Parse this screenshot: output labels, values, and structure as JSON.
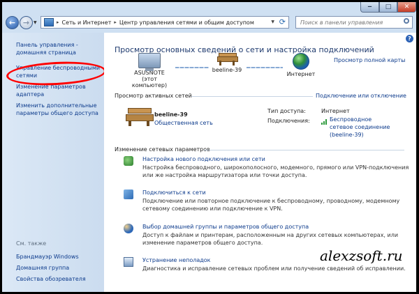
{
  "window_controls": {
    "minimize": "‒",
    "maximize": "□",
    "close": "✕"
  },
  "nav": {
    "back_glyph": "←",
    "forward_glyph": "→",
    "breadcrumb": [
      "Сеть и Интернет",
      "Центр управления сетями и общим доступом"
    ],
    "search_placeholder": "Поиск в панели управления"
  },
  "sidebar": {
    "links": [
      "Панель управления - домашняя страница",
      "Управление беспроводными сетями",
      "Изменение параметров адаптера",
      "Изменить дополнительные параметры общего доступа"
    ],
    "see_also_title": "См. также",
    "see_also": [
      "Брандмауэр Windows",
      "Домашняя группа",
      "Свойства обозревателя"
    ]
  },
  "main": {
    "title": "Просмотр основных сведений о сети и настройка подключений",
    "full_map": "Просмотр полной карты",
    "map": [
      {
        "name": "ASUSNOTE",
        "sub": "(этот компьютер)",
        "icon": "computer-icon"
      },
      {
        "name": "beeline-39",
        "sub": "",
        "icon": "bench-icon"
      },
      {
        "name": "Интернет",
        "sub": "",
        "icon": "globe-icon"
      }
    ],
    "active_title": "Просмотр активных сетей",
    "connect_disconnect": "Подключение или отключение",
    "active_network": {
      "name": "beeline-39",
      "type": "Общественная сеть",
      "access_label": "Тип доступа:",
      "access_value": "Интернет",
      "connections_label": "Подключения:",
      "connections_value": "Беспроводное сетевое соединение (beeline-39)"
    },
    "change_title": "Изменение сетевых параметров",
    "tasks": [
      {
        "title": "Настройка нового подключения или сети",
        "desc": "Настройка беспроводного, широкополосного, модемного, прямого или VPN-подключения или же настройка маршрутизатора или точки доступа.",
        "icon": "new-connection-icon"
      },
      {
        "title": "Подключиться к сети",
        "desc": "Подключение или повторное подключение к беспроводному, проводному, модемному сетевому соединению или подключение к VPN.",
        "icon": "connect-network-icon"
      },
      {
        "title": "Выбор домашней группы и параметров общего доступа",
        "desc": "Доступ к файлам и принтерам, расположенным на других сетевых компьютерах, или изменение параметров общего доступа.",
        "icon": "homegroup-icon"
      },
      {
        "title": "Устранение неполадок",
        "desc": "Диагностика и исправление сетевых проблем или получение сведений об исправлении.",
        "icon": "troubleshoot-icon"
      }
    ]
  },
  "watermark": "alexzsoft.ru"
}
